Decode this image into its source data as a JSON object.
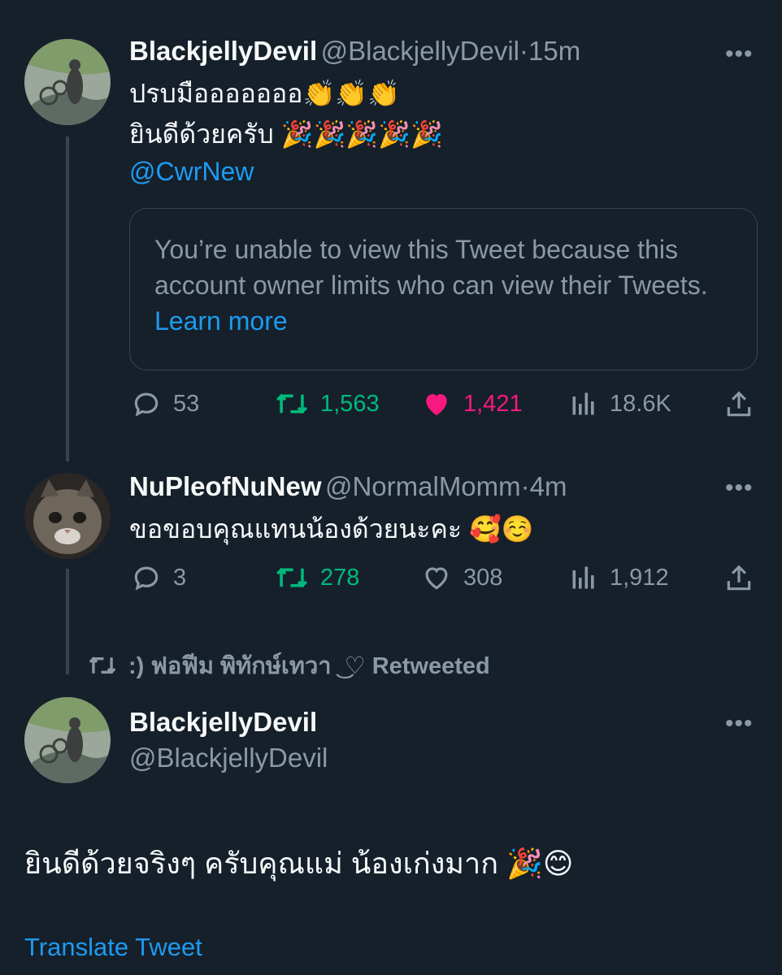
{
  "tweet1": {
    "display_name": "BlackjellyDevil",
    "handle": "@BlackjellyDevil",
    "time": "15m",
    "line1": "ปรบมือออออออ👏👏👏",
    "line2": "ยินดีด้วยครับ 🎉🎉🎉🎉🎉",
    "mention": "@CwrNew",
    "quote_text": "You’re unable to view this Tweet because this account owner limits who can view their Tweets.",
    "quote_link": "Learn more",
    "replies": "53",
    "retweets": "1,563",
    "likes": "1,421",
    "views": "18.6K"
  },
  "tweet2": {
    "display_name": "NuPleofNuNew",
    "handle": "@NormalMomm",
    "time": "4m",
    "text": "ขอขอบคุณแทนน้องด้วยนะคะ 🥰☺️",
    "replies": "3",
    "retweets": "278",
    "likes": "308",
    "views": "1,912"
  },
  "retweet_bar": {
    "text": ":) ฟอฟีม พิทักษ์เทวา ͜ ♡ Retweeted"
  },
  "tweet3": {
    "display_name": "BlackjellyDevil",
    "handle": "@BlackjellyDevil",
    "text": "ยินดีด้วยจริงๆ ครับคุณแม่ น้องเก่งมาก 🎉😊",
    "translate": "Translate Tweet"
  },
  "separator": "·",
  "more_icon": "•••",
  "colors": {
    "background": "#15202b",
    "accent": "#1d9bf0",
    "retweet_green": "#00ba7c",
    "like_pink": "#f91880",
    "muted": "#8b98a5"
  }
}
